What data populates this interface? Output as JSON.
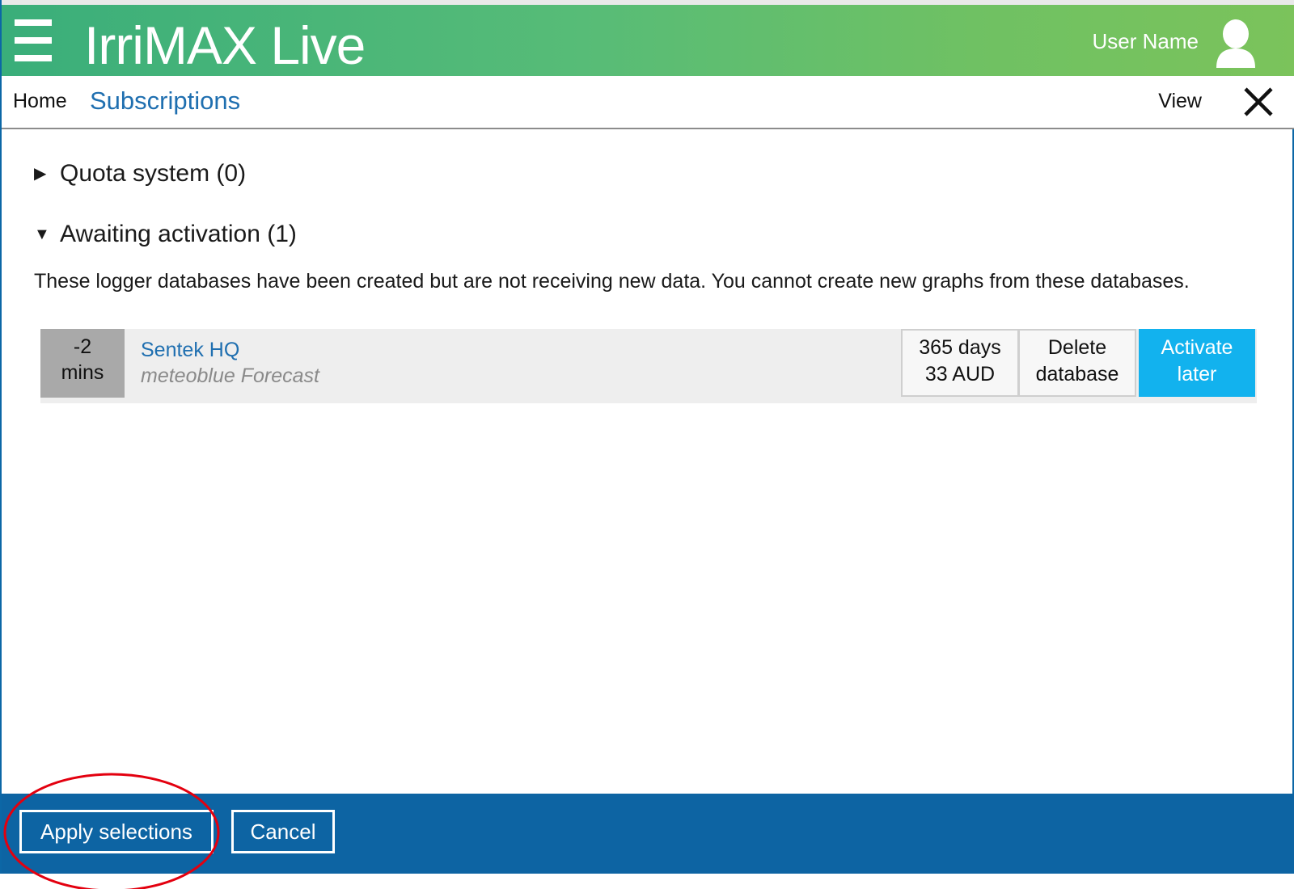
{
  "header": {
    "menu_icon": "hamburger-menu-icon",
    "app_title": "IrriMAX Live",
    "user_name": "User Name",
    "user_icon": "user-avatar-icon",
    "background_color_start": "#3aae7a",
    "background_color_end": "#7bc35b"
  },
  "nav": {
    "home_label": "Home",
    "current_page": "Subscriptions",
    "view_label": "View",
    "close_icon": "close-icon",
    "link_color": "#1f6fb0"
  },
  "sections": {
    "quota": {
      "label": "Quota system (0)",
      "expanded": false
    },
    "awaiting": {
      "label": "Awaiting activation (1)",
      "expanded": true,
      "description": "These logger databases have been created but are not receiving new data. You cannot create new graphs from these databases."
    }
  },
  "databases": [
    {
      "age_value": "-2",
      "age_unit": "mins",
      "name": "Sentek HQ",
      "type": "meteoblue Forecast",
      "duration": "365 days",
      "price": "33 AUD",
      "delete_line1": "Delete",
      "delete_line2": "database",
      "activate_line1": "Activate",
      "activate_line2": "later",
      "activate_color": "#12b2ee"
    }
  ],
  "footer": {
    "apply_label": "Apply selections",
    "cancel_label": "Cancel",
    "background_color": "#0d64a3",
    "highlight_color": "#e3000f"
  }
}
